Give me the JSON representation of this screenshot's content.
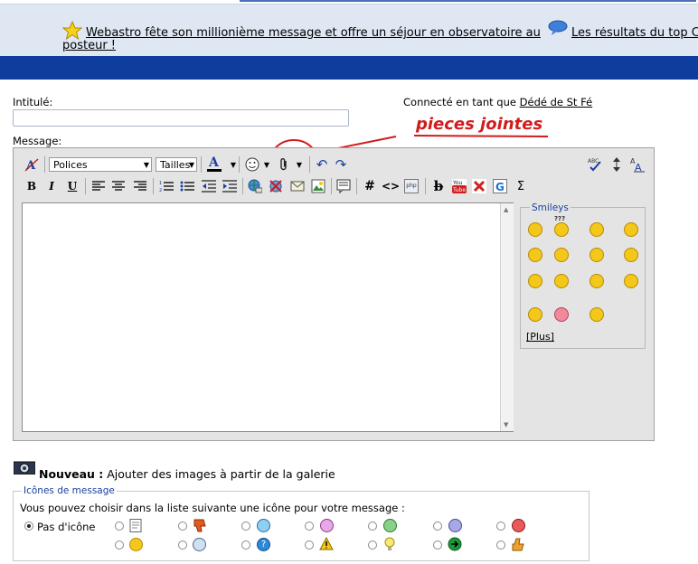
{
  "news": {
    "item1": "Webastro fête son millionième message et offre un séjour en observatoire au posteur !",
    "item2": "Les résultats du top C shirt WA et bons d'achat..."
  },
  "form": {
    "title_label": "Intitulé:",
    "title_value": "",
    "connected_prefix": "Connecté en tant que",
    "username": "Dédé de St Fé",
    "message_label": "Message:",
    "annotation": "pieces jointes"
  },
  "toolbar": {
    "font_select": "Polices",
    "size_select": "Tailles",
    "bold": "B",
    "italic": "I",
    "underline": "U",
    "hash": "#",
    "code": "<>",
    "php": "php",
    "sigma": "Σ",
    "abc": "ABC"
  },
  "smileys": {
    "title": "Smileys",
    "more_link": "[Plus]",
    "confused_marks": "???"
  },
  "gallery": {
    "new_label": "Nouveau :",
    "text": "Ajouter des images à partir de la galerie"
  },
  "message_icons": {
    "legend": "Icônes de message",
    "instruction": "Vous pouvez choisir dans la liste suivante une icône pour votre message :",
    "no_icon_label": "Pas d'icône"
  },
  "colors": {
    "news_bg": "#dfe7f3",
    "blue_bar": "#0e3d9e",
    "annotation": "#d01c1c",
    "editor_bg": "#e4e4e4"
  }
}
